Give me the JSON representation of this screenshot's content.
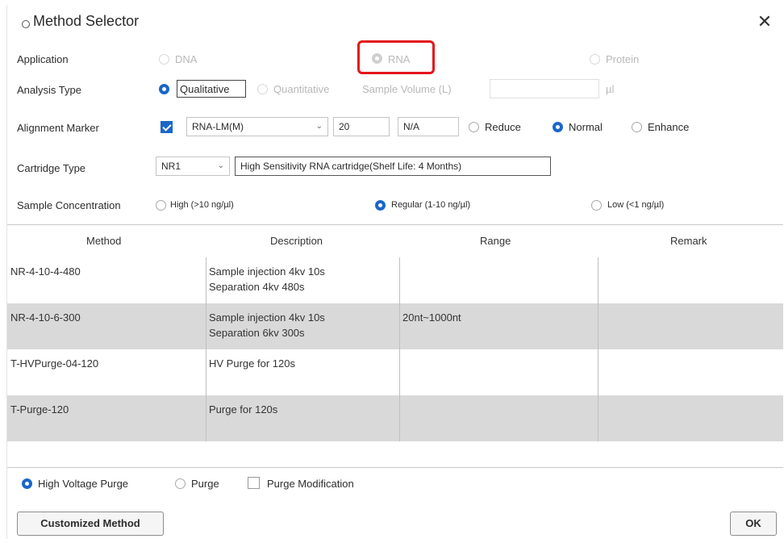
{
  "window": {
    "title": "Method Selector",
    "close_symbol": "✕"
  },
  "application": {
    "label": "Application",
    "options": [
      "DNA",
      "RNA",
      "Protein"
    ],
    "selected": "RNA"
  },
  "analysis_type": {
    "label": "Analysis Type",
    "options": [
      "Qualitative",
      "Quantitative"
    ],
    "selected": "Qualitative",
    "sample_volume_label": "Sample Volume (L)",
    "sample_volume_value": "",
    "sample_volume_unit": "µl"
  },
  "alignment_marker": {
    "label": "Alignment Marker",
    "enabled": true,
    "marker": "RNA-LM(M)",
    "size": "20",
    "unit": "N/A",
    "options": [
      "Reduce",
      "Normal",
      "Enhance"
    ],
    "selected": "Normal"
  },
  "cartridge": {
    "label": "Cartridge Type",
    "type": "NR1",
    "description": "High Sensitivity RNA cartridge(Shelf Life: 4 Months)"
  },
  "sample_concentration": {
    "label": "Sample Concentration",
    "options": [
      "High (>10 ng/µl)",
      "Regular (1-10 ng/µl)",
      "Low (<1 ng/µl)"
    ],
    "selected": "Regular (1-10 ng/µl)"
  },
  "table": {
    "columns": [
      "Method",
      "Description",
      "Range",
      "Remark"
    ],
    "rows": [
      {
        "method": "NR-4-10-4-480",
        "description": [
          "Sample injection 4kv 10s",
          "Separation 4kv 480s"
        ],
        "range": "",
        "remark": ""
      },
      {
        "method": "NR-4-10-6-300",
        "description": [
          "Sample injection 4kv 10s",
          "Separation 6kv 300s"
        ],
        "range": "20nt~1000nt",
        "remark": ""
      },
      {
        "method": "T-HVPurge-04-120",
        "description": [
          "HV Purge for 120s"
        ],
        "range": "",
        "remark": ""
      },
      {
        "method": "T-Purge-120",
        "description": [
          "Purge for 120s"
        ],
        "range": "",
        "remark": ""
      }
    ]
  },
  "purge": {
    "options": [
      "High Voltage Purge",
      "Purge"
    ],
    "selected": "High Voltage Purge",
    "modification_label": "Purge Modification",
    "modification_checked": false
  },
  "buttons": {
    "customized": "Customized Method",
    "ok": "OK"
  },
  "colors": {
    "accent": "#1a67c9",
    "highlight": "#e4151a",
    "alt_row": "#d9d9d9"
  }
}
